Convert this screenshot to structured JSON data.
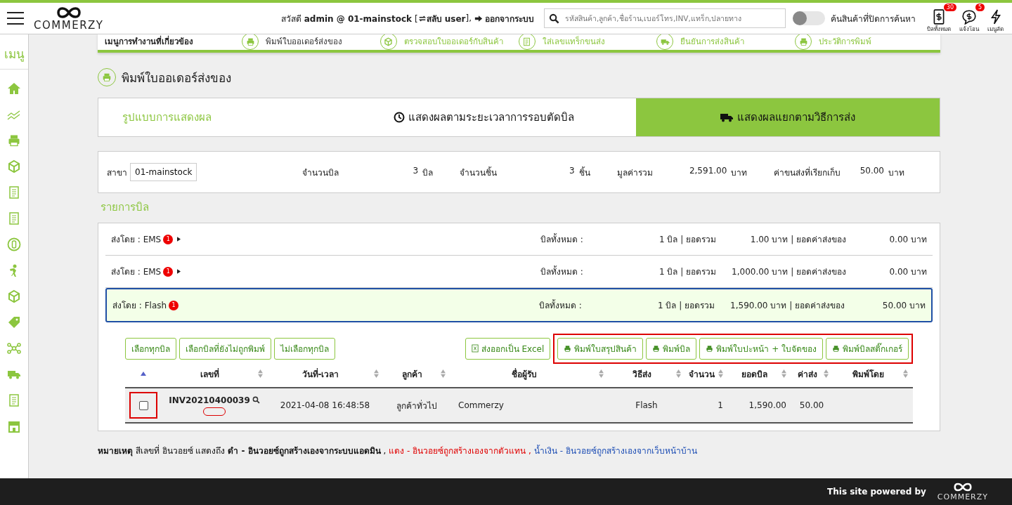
{
  "header": {
    "brand": "COMMERZY",
    "greeting": "สวัสดี **admin @ 01-mainstock** [",
    "switch_label": "สลับ user",
    "bracket_close": "],",
    "logout": "ออกจากระบบ",
    "search": {
      "placeholder": "รหัสสินค้า,ลูกค้า,ชื่อร้าน,เบอร์โทร,INV,แทร็ก,ปลายทาง"
    },
    "toggle": {
      "label": "ค้นสินค้าที่ปิดการค้นหา",
      "on": false
    },
    "shortcuts": [
      {
        "kind": "bill",
        "label": "บิลทั้งหมด",
        "badge": "30"
      },
      {
        "kind": "chat",
        "label": "แจ้งโอน",
        "badge": "5"
      },
      {
        "kind": "bolt",
        "label": "เมนูลัด"
      }
    ]
  },
  "sidebar": {
    "title": "เมนู"
  },
  "related_menu": {
    "title": "เมนูการทำงานที่เกี่ยวข้อง",
    "items": [
      {
        "label": "พิมพ์ใบออเดอร์ส่งของ",
        "selected": true
      },
      {
        "label": "ตรวจสอบใบออเดอร์กับสินค้า",
        "selected": false
      },
      {
        "label": "ใส่เลขแทร็กขนส่ง",
        "selected": false
      },
      {
        "label": "ยืนยันการส่งสินค้า",
        "selected": false
      },
      {
        "label": "ประวัติการพิมพ์",
        "selected": false
      }
    ]
  },
  "page_title": "พิมพ์ใบออเดอร์ส่งของ",
  "view_tabs": {
    "label": "รูปแบบการแสดงผล",
    "tabs": [
      {
        "kind": "clock",
        "label": "แสดงผลตามระยะเวลาการรอบตัดบิล",
        "selected": false
      },
      {
        "kind": "truck",
        "label": "แสดงผลแยกตามวิธีการส่ง",
        "selected": true
      }
    ]
  },
  "summary": {
    "branch_label": "สาขา",
    "branch_value": "01-mainstock",
    "stats": [
      {
        "label": "จำนวนบิล",
        "value": "3",
        "unit": "บิล"
      },
      {
        "label": "จำนวนชิ้น",
        "value": "3",
        "unit": "ชิ้น"
      },
      {
        "label": "มูลค่ารวม",
        "value": "2,591.00",
        "unit": "บาท"
      },
      {
        "label": "ค่าขนส่งที่เรียกเก็บ",
        "value": "50.00",
        "unit": "บาท"
      }
    ]
  },
  "bills_title": "รายการบิล",
  "groups": [
    {
      "carrier": "ส่งโดย : EMS",
      "badge": "1",
      "expanded": false,
      "total_label": "บิลทั้งหมด :",
      "count": "1 บิล | ยอดรวม",
      "amount": "1.00 บาท | ยอดค่าส่งของ",
      "shipping": "0.00 บาท"
    },
    {
      "carrier": "ส่งโดย : EMS",
      "badge": "1",
      "expanded": false,
      "total_label": "บิลทั้งหมด :",
      "count": "1 บิล | ยอดรวม",
      "amount": "1,000.00 บาท | ยอดค่าส่งของ",
      "shipping": "0.00 บาท"
    },
    {
      "carrier": "ส่งโดย : Flash",
      "badge": "1",
      "expanded": true,
      "total_label": "บิลทั้งหมด :",
      "count": "1 บิล | ยอดรวม",
      "amount": "1,590.00 บาท | ยอดค่าส่งของ",
      "shipping": "50.00 บาท"
    }
  ],
  "bill_actions": {
    "select_buttons": [
      "เลือกทุกบิล",
      "เลือกบิลที่ยังไม่ถูกพิมพ์",
      "ไม่เลือกทุกบิล"
    ],
    "export": "ส่งออกเป็น Excel",
    "print_highlighted": true,
    "print_buttons": [
      "พิมพ์ใบสรุปสินค้า",
      "พิมพ์บิล",
      "พิมพ์ใบปะหน้า + ใบจัดของ",
      "พิมพ์บิลสติ๊กเกอร์"
    ]
  },
  "table": {
    "sort_ascending": true,
    "columns": [
      "เลขที่",
      "วันที่-เวลา",
      "ลูกค้า",
      "ชื่อผู้รับ",
      "วิธีส่ง",
      "จำนวน",
      "ยอดบิล",
      "ค่าส่ง",
      "พิมพ์โดย"
    ],
    "rows": [
      {
        "checked": false,
        "highlighted": true,
        "cells": [
          "INV20210400039",
          "2021-04-08 16:48:58",
          "ลูกค้าทั่วไป",
          "Commerzy",
          "Flash",
          "1",
          "1,590.00",
          "50.00"
        ]
      }
    ]
  },
  "note": [
    {
      "text": "**หมายเหตุ** สีเลขที่ อินวอยซ์ แสดงถึง **ดำ - อินวอยซ์ถูกสร้างเองจากระบบแอดมิน** ,",
      "color": "#111111"
    },
    {
      "text": "แดง - อินวอยซ์ถูกสร้างเองจากตัวแทน ,",
      "color": "#e00000"
    },
    {
      "text": "น้ำเงิน - อินวอยซ์ถูกสร้างเองจากเว็บหน้าบ้าน",
      "color": "#1f4fb5"
    }
  ],
  "footer": {
    "text": "This site powered by",
    "brand": "COMMERZY"
  }
}
